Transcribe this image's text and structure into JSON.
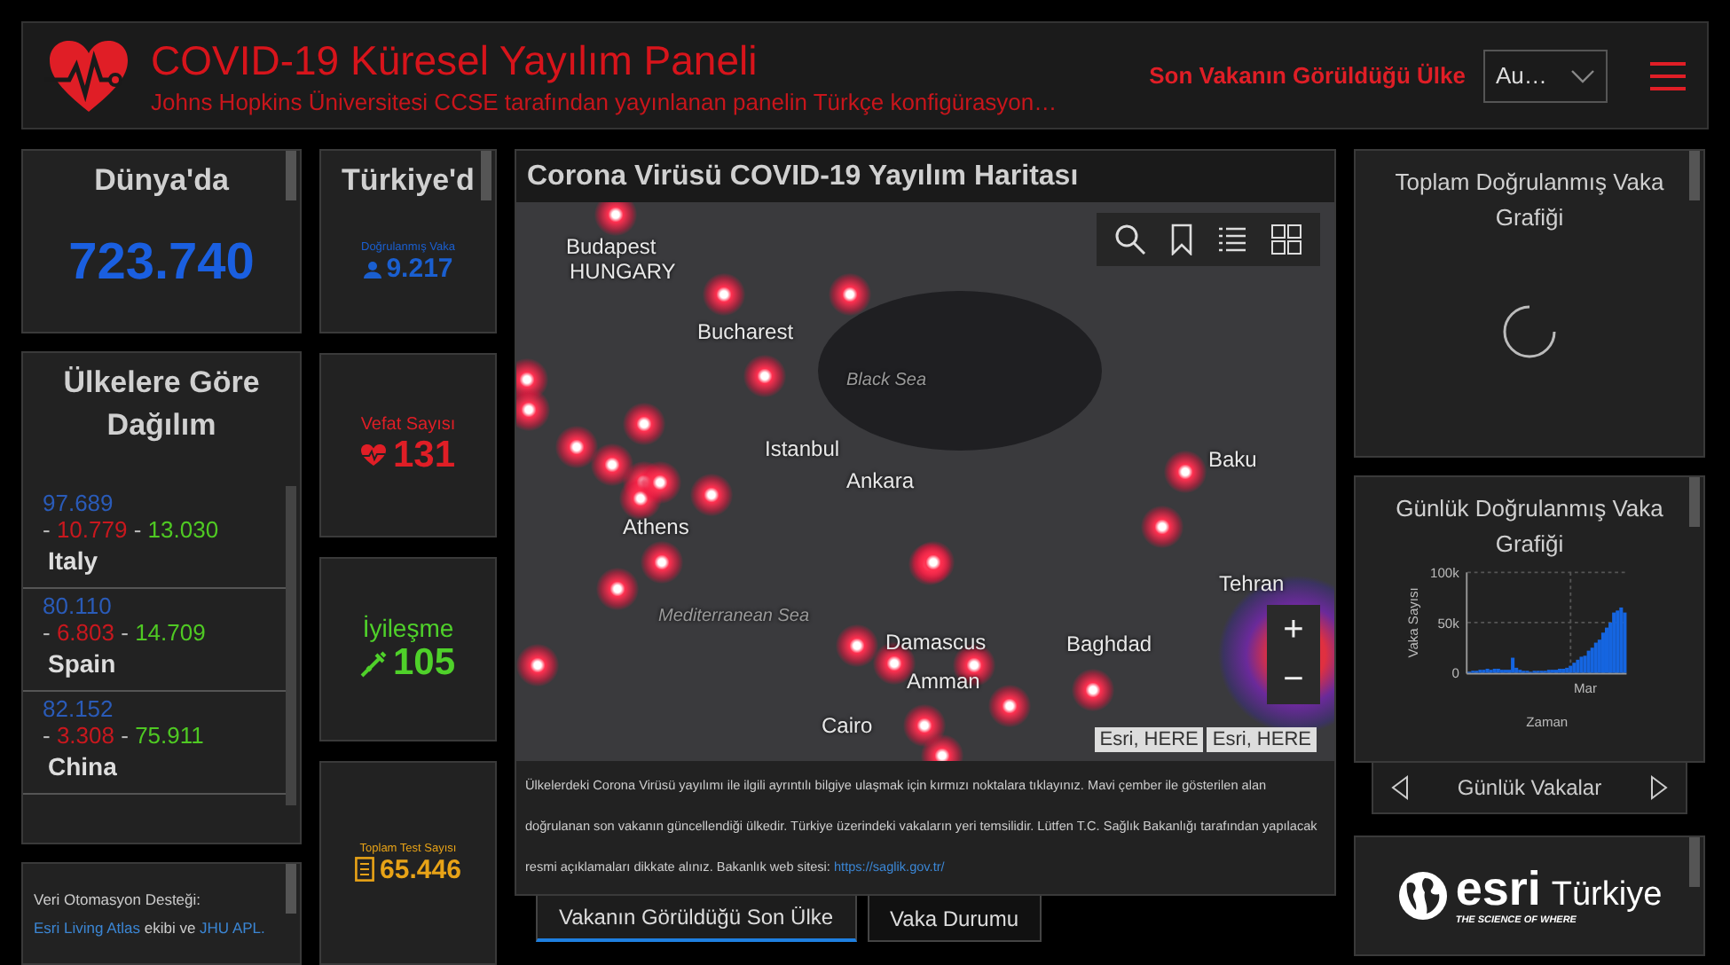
{
  "header": {
    "title": "COVID-19 Küresel Yayılım Paneli",
    "subtitle": "Johns Hopkins Üniversitesi CCSE tarafından yayınlanan panelin Türkçe konfigürasyon…",
    "selector_label": "Son Vakanın Görüldüğü Ülke",
    "selector_value": "Au…"
  },
  "world": {
    "title": "Dünya'da",
    "value": "723.740"
  },
  "countries": {
    "title": "Ülkelere Göre Dağılım",
    "items": [
      {
        "confirmed": "97.689",
        "separator": "-",
        "deaths": "10.779",
        "recovered": "13.030",
        "name": "Italy"
      },
      {
        "confirmed": "80.110",
        "separator": "-",
        "deaths": "6.803",
        "recovered": "14.709",
        "name": "Spain"
      },
      {
        "confirmed": "82.152",
        "separator": "-",
        "deaths": "3.308",
        "recovered": "75.911",
        "name": "China"
      }
    ]
  },
  "credits": {
    "prefix": "Veri Otomasyon Desteği: ",
    "link1": "Esri Living Atlas",
    "middle": " ekibi ve ",
    "link2": "JHU APL."
  },
  "turkey": {
    "title": "Türkiye'd",
    "stats": [
      {
        "kind": "confirmed",
        "label": "Doğrulanmış Vaka",
        "value": "9.217",
        "color": "#1a5fd0"
      },
      {
        "kind": "deaths",
        "label": "Vefat Sayısı",
        "value": "131",
        "color": "#e01e26"
      },
      {
        "kind": "recovered",
        "label": "İyileşme",
        "value": "105",
        "color": "#4fd12a"
      },
      {
        "kind": "tests",
        "label": "Toplam Test Sayısı",
        "value": "65.446",
        "color": "#e8a317"
      }
    ]
  },
  "map": {
    "title": "Corona Virüsü COVID-19 Yayılım Haritası",
    "labels": [
      "Budapest",
      "HUNGARY",
      "Bucharest",
      "Black Sea",
      "Istanbul",
      "Ankara",
      "Baku",
      "Athens",
      "Tehran",
      "Mediterranean Sea",
      "Damascus",
      "Baghdad",
      "Amman",
      "Cairo"
    ],
    "zoom_in": "+",
    "zoom_out": "−",
    "attribution": [
      "Esri, HERE",
      "Esri, HERE"
    ],
    "description": "Ülkelerdeki Corona Virüsü yayılımı ile ilgili ayrıntılı bilgiye ulaşmak için kırmızı noktalara tıklayınız. Mavi çember ile gösterilen alan doğrulanan son vakanın güncellendiği ülkedir. Türkiye üzerindeki vakaların yeri temsilidir. Lütfen T.C. Sağlık Bakanlığı tarafından yapılacak resmi açıklamaları dikkate alınız. Bakanlık web sitesi: ",
    "link": "https://saglik.gov.tr/"
  },
  "tabs": [
    {
      "label": "Vakanın Görüldüğü Son Ülke",
      "selected": true
    },
    {
      "label": "Vaka Durumu",
      "selected": false
    }
  ],
  "total_chart": {
    "title": "Toplam Doğrulanmış Vaka Grafiği"
  },
  "daily_chart": {
    "title": "Günlük Doğrulanmış Vaka Grafiği",
    "nav_label": "Günlük Vakalar",
    "chart_data": {
      "type": "bar",
      "xlabel": "Zaman",
      "ylabel": "Vaka Sayısı",
      "series": [
        {
          "color": "#1565e0",
          "values": [
            1000,
            2000,
            2000,
            3000,
            3000,
            4000,
            3000,
            4000,
            4000,
            3000,
            3000,
            3000,
            15000,
            5000,
            3000,
            2000,
            2000,
            1000,
            2000,
            2000,
            2000,
            2000,
            3000,
            3000,
            3000,
            4000,
            4000,
            5000,
            7000,
            10000,
            13000,
            16000,
            17000,
            22000,
            25000,
            30000,
            33000,
            40000,
            45000,
            50000,
            60000,
            62000,
            65000,
            60000
          ]
        }
      ],
      "ylim": [
        0,
        100000
      ],
      "yticks": [
        {
          "value": 0,
          "label": "0"
        },
        {
          "value": 50000,
          "label": "50k"
        },
        {
          "value": 100000,
          "label": "100k"
        }
      ]
    },
    "month_label": "Mar"
  },
  "esri": {
    "wordmark": "esri",
    "country": "Türkiye",
    "tagline": "THE SCIENCE OF WHERE"
  }
}
